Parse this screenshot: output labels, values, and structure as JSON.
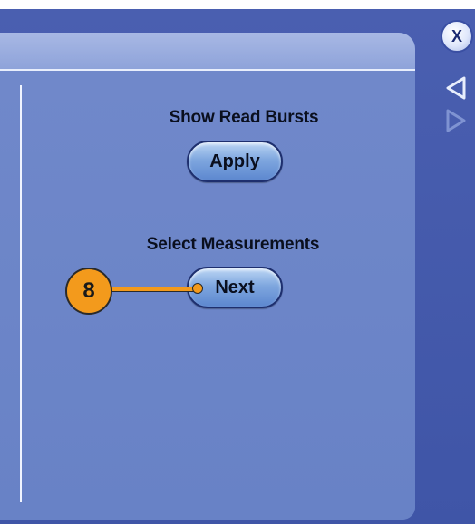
{
  "sections": [
    {
      "label": "Show Read Bursts",
      "button_label": "Apply"
    },
    {
      "label": "Select Measurements",
      "button_label": "Next"
    }
  ],
  "controls": {
    "close_label": "X"
  },
  "callout": {
    "number": "8",
    "color": "#f39a1c"
  },
  "colors": {
    "panel": "#6b86c9",
    "frame": "#4a5fb0",
    "header": "#a8b8e4"
  },
  "icons": [
    "close-icon",
    "triangle-left-icon",
    "triangle-right-icon"
  ]
}
